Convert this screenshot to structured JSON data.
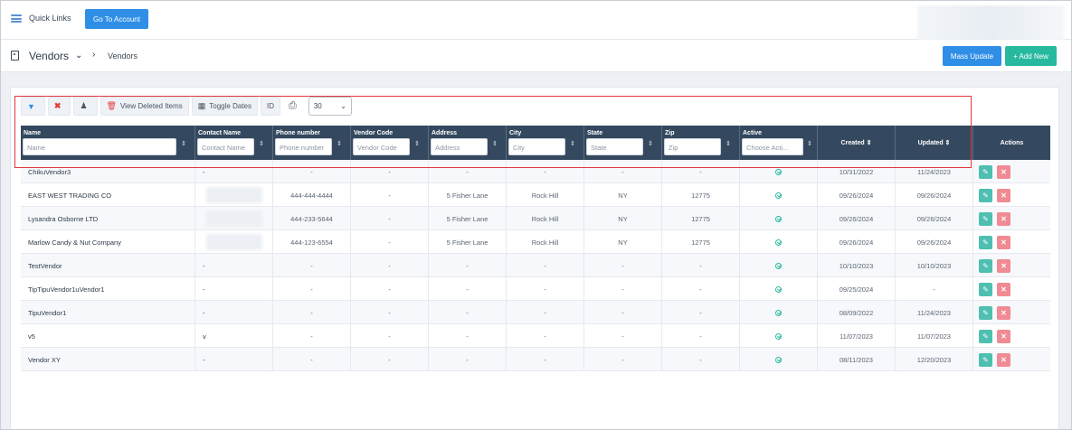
{
  "topbar": {
    "quick_links": "Quick Links",
    "go_to_account": "Go To Account"
  },
  "header": {
    "title": "Vendors",
    "breadcrumb": "Vendors",
    "mass_update": "Mass Update",
    "add_new": "+ Add New"
  },
  "toolbar": {
    "view_deleted": "View Deleted Items",
    "toggle_dates": "Toggle Dates",
    "id": "ID",
    "page_size": "30"
  },
  "columns": [
    {
      "label": "Name",
      "placeholder": "Name"
    },
    {
      "label": "Contact Name",
      "placeholder": "Contact Name"
    },
    {
      "label": "Phone number",
      "placeholder": "Phone number"
    },
    {
      "label": "Vendor Code",
      "placeholder": "Vendor Code"
    },
    {
      "label": "Address",
      "placeholder": "Address"
    },
    {
      "label": "City",
      "placeholder": "City"
    },
    {
      "label": "State",
      "placeholder": "State"
    },
    {
      "label": "Zip",
      "placeholder": "Zip"
    },
    {
      "label": "Active",
      "placeholder": "Choose Acti..."
    },
    {
      "label": "Created"
    },
    {
      "label": "Updated"
    },
    {
      "label": "Actions"
    }
  ],
  "rows": [
    {
      "name": "ChikuVendor3",
      "contact": "-",
      "phone": "-",
      "code": "-",
      "address": "-",
      "city": "-",
      "state": "-",
      "zip": "-",
      "created": "10/31/2022",
      "updated": "11/24/2023"
    },
    {
      "name": "EAST WEST TRADING CO",
      "contact": "",
      "phone": "444-444-4444",
      "code": "-",
      "address": "5 Fisher Lane",
      "city": "Rock Hill",
      "state": "NY",
      "zip": "12775",
      "created": "09/26/2024",
      "updated": "09/26/2024"
    },
    {
      "name": "Lysandra Osborne LTD",
      "contact": "",
      "phone": "444-233-5644",
      "code": "-",
      "address": "5 Fisher Lane",
      "city": "Rock Hill",
      "state": "NY",
      "zip": "12775",
      "created": "09/26/2024",
      "updated": "09/26/2024"
    },
    {
      "name": "Marlow Candy & Nut Company",
      "contact": "",
      "phone": "444-123-6554",
      "code": "-",
      "address": "5 Fisher Lane",
      "city": "Rock Hill",
      "state": "NY",
      "zip": "12775",
      "created": "09/26/2024",
      "updated": "09/26/2024"
    },
    {
      "name": "TestVendor",
      "contact": "-",
      "phone": "-",
      "code": "-",
      "address": "-",
      "city": "-",
      "state": "-",
      "zip": "-",
      "created": "10/10/2023",
      "updated": "10/10/2023"
    },
    {
      "name": "TipTipuVendor1uVendor1",
      "contact": "-",
      "phone": "-",
      "code": "-",
      "address": "-",
      "city": "-",
      "state": "-",
      "zip": "-",
      "created": "09/25/2024",
      "updated": "-"
    },
    {
      "name": "TipuVendor1",
      "contact": "-",
      "phone": "-",
      "code": "-",
      "address": "-",
      "city": "-",
      "state": "-",
      "zip": "-",
      "created": "08/09/2022",
      "updated": "11/24/2023"
    },
    {
      "name": "v5",
      "contact": "v",
      "phone": "-",
      "code": "-",
      "address": "-",
      "city": "-",
      "state": "-",
      "zip": "-",
      "created": "11/07/2023",
      "updated": "11/07/2023"
    },
    {
      "name": "Vendor XY",
      "contact": "-",
      "phone": "-",
      "code": "-",
      "address": "-",
      "city": "-",
      "state": "-",
      "zip": "-",
      "created": "08/11/2023",
      "updated": "12/20/2023"
    }
  ],
  "colors": {
    "primary": "#2f8ee6",
    "success": "#27b99f",
    "header_bg": "#34495f",
    "danger": "#e23c3c"
  },
  "icons": {
    "edit": "pencil-icon",
    "delete": "close-icon",
    "active": "check-circle-icon"
  }
}
